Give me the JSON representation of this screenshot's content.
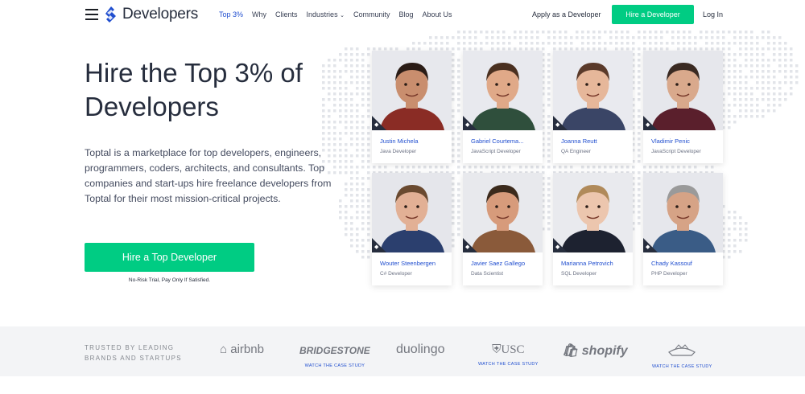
{
  "nav": {
    "logo_text": "Developers",
    "links": [
      "Top 3%",
      "Why",
      "Clients",
      "Industries",
      "Community",
      "Blog",
      "About Us"
    ],
    "apply_label": "Apply as a Developer",
    "hire_label": "Hire a Developer",
    "login_label": "Log In",
    "icons": {
      "menu": "hamburger-icon",
      "logo": "toptal-logo-icon",
      "caret": "chevron-down-icon"
    }
  },
  "hero": {
    "title": "Hire the Top 3% of Developers",
    "description": "Toptal is a marketplace for top developers, engineers, programmers, coders, architects, and consultants. Top companies and start-ups hire freelance developers from Toptal for their most mission-critical projects.",
    "cta_label": "Hire a Top Developer",
    "cta_note": "No-Risk Trial, Pay Only If Satisfied."
  },
  "developers": [
    {
      "name": "Justin Michela",
      "role": "Java Developer"
    },
    {
      "name": "Gabriel Courtemanche",
      "role": "JavaScript Developer"
    },
    {
      "name": "Joanna Reutt",
      "role": "QA Engineer"
    },
    {
      "name": "Vladimir Penic",
      "role": "JavaScript Developer"
    },
    {
      "name": "Wouter Steenbergen",
      "role": "C# Developer"
    },
    {
      "name": "Javier Saez Gallego",
      "role": "Data Scientist"
    },
    {
      "name": "Marianna Petrovich",
      "role": "SQL Developer"
    },
    {
      "name": "Chady Kassouf",
      "role": "PHP Developer"
    }
  ],
  "trusted": {
    "label": "TRUSTED BY LEADING BRANDS AND STARTUPS",
    "brands": [
      {
        "name": "airbnb",
        "case": ""
      },
      {
        "name": "BRIDGESTONE",
        "case": "WATCH THE CASE STUDY"
      },
      {
        "name": "duolingo",
        "case": ""
      },
      {
        "name": "USC",
        "case": "WATCH THE CASE STUDY"
      },
      {
        "name": "shopify",
        "case": ""
      },
      {
        "name": "Cavaliers",
        "case": "WATCH THE CASE STUDY"
      }
    ]
  },
  "colors": {
    "accent": "#00cc83",
    "link": "#204ecf",
    "text": "#262d3d"
  }
}
